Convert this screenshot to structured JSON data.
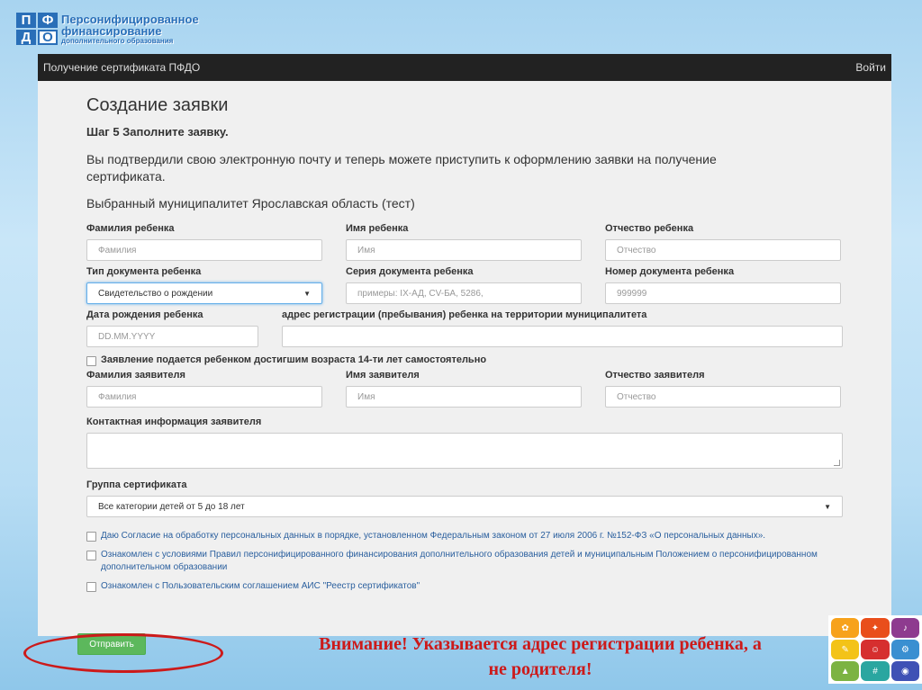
{
  "logo": {
    "letters": [
      "П",
      "Ф",
      "Д",
      "О"
    ],
    "line1": "Персонифицированное",
    "line2": "финансирование",
    "line3": "дополнительного образования"
  },
  "navbar": {
    "title": "Получение сертификата ПФДО",
    "login": "Войти"
  },
  "page_title": "Создание заявки",
  "step": "Шаг 5 Заполните заявку.",
  "intro": "Вы подтвердили свою электронную почту и теперь можете приступить к оформлению заявки на получение сертификата.",
  "municipality": "Выбранный муниципалитет Ярославская область (тест)",
  "child": {
    "last_name_label": "Фамилия ребенка",
    "last_name_ph": "Фамилия",
    "first_name_label": "Имя ребенка",
    "first_name_ph": "Имя",
    "patronymic_label": "Отчество ребенка",
    "patronymic_ph": "Отчество",
    "doc_type_label": "Тип документа ребенка",
    "doc_type_value": "Свидетельство о рождении",
    "doc_series_label": "Серия документа ребенка",
    "doc_series_ph": "примеры: IX-АД, CV-БА, 5286,",
    "doc_number_label": "Номер документа ребенка",
    "doc_number_ph": "999999",
    "birth_label": "Дата рождения ребенка",
    "birth_ph": "DD.MM.YYYY",
    "address_label": "адрес регистрации (пребывания) ребенка на территории муниципалитета"
  },
  "self_apply": "Заявление подается ребенком достигшим возраста 14-ти лет самостоятельно",
  "applicant": {
    "last_name_label": "Фамилия заявителя",
    "last_name_ph": "Фамилия",
    "first_name_label": "Имя заявителя",
    "first_name_ph": "Имя",
    "patronymic_label": "Отчество заявителя",
    "patronymic_ph": "Отчество",
    "contact_label": "Контактная информация заявителя"
  },
  "group": {
    "label": "Группа сертификата",
    "value": "Все категории детей от 5 до 18 лет"
  },
  "consents": [
    "Даю Согласие на обработку персональных данных в порядке, установленном Федеральным законом от 27 июля 2006 г. №152-ФЗ «О персональных данных».",
    "Ознакомлен с условиями Правил персонифицированного финансирования дополнительного образования детей и муниципальным Положением о персонифицированном дополнительном образовании",
    "Ознакомлен с Пользовательским соглашением АИС \"Реестр сертификатов\""
  ],
  "submit_label": "Отправить",
  "notice_line1": "Внимание! Указывается адрес регистрации ребенка, а",
  "notice_line2": "не родителя!",
  "colors": {
    "accent": "#5cb85c",
    "notice": "#cc1a1a",
    "navbar": "#222222"
  }
}
